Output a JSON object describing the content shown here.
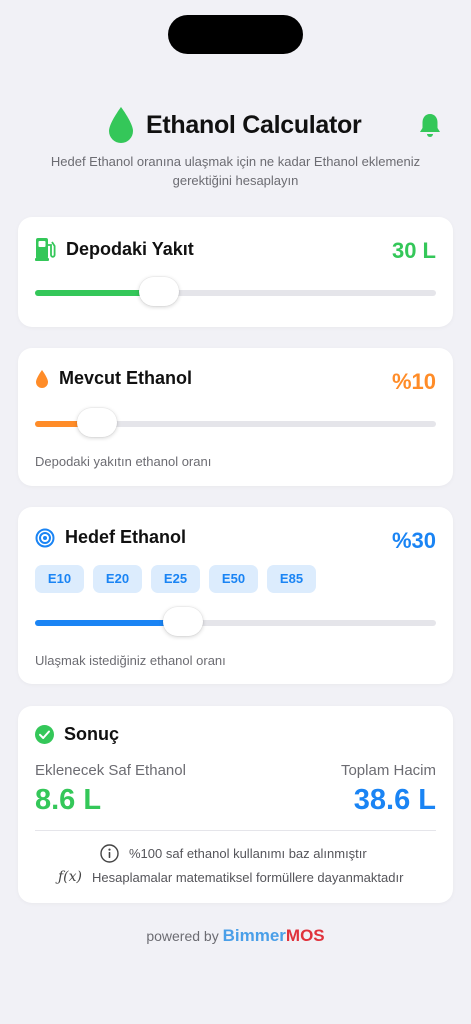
{
  "header": {
    "title": "Ethanol Calculator",
    "subtitle": "Hedef Ethanol oranına ulaşmak için ne kadar Ethanol eklemeniz gerektiğini hesaplayın",
    "icons": {
      "logo": "drop-icon",
      "notifications": "bell-icon"
    }
  },
  "tank": {
    "label": "Depodaki Yakıt",
    "value": "30 L",
    "slider_fraction": 0.31,
    "color": "#34c759",
    "icon": "fuel-pump-icon"
  },
  "current": {
    "label": "Mevcut Ethanol",
    "value": "%10",
    "slider_fraction": 0.155,
    "color": "#ff8c28",
    "hint": "Depodaki yakıtın ethanol oranı",
    "icon": "drop-icon"
  },
  "target": {
    "label": "Hedef Ethanol",
    "value": "%30",
    "slider_fraction": 0.37,
    "color": "#1a84f4",
    "hint": "Ulaşmak istediğiniz ethanol oranı",
    "icon": "target-icon",
    "presets": [
      "E10",
      "E20",
      "E25",
      "E50",
      "E85"
    ]
  },
  "result": {
    "title": "Sonuç",
    "icon": "checkmark-circle-icon",
    "add_label": "Eklenecek Saf Ethanol",
    "add_value": "8.6 L",
    "total_label": "Toplam Hacim",
    "total_value": "38.6 L",
    "notes": [
      {
        "icon": "info-icon",
        "text": "%100 saf ethanol kullanımı baz alınmıştır"
      },
      {
        "icon": "function-icon",
        "text": "Hesaplamalar matematiksel formüllere dayanmaktadır"
      }
    ]
  },
  "footer": {
    "powered": "powered by",
    "brand_part1": "Bimmer",
    "brand_part2": "MOS"
  }
}
